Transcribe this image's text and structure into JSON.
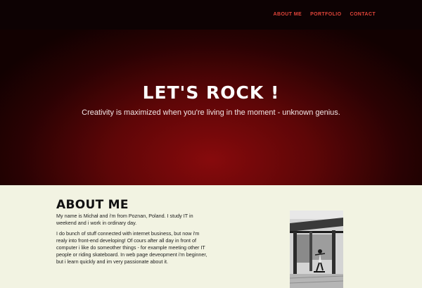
{
  "nav": {
    "items": [
      {
        "label": "ABOUT ME"
      },
      {
        "label": "PORTFOLIO"
      },
      {
        "label": "CONTACT"
      }
    ]
  },
  "hero": {
    "title": "LET'S ROCK !",
    "subtitle": "Creativity is maximized when you're living in the moment - unknown genius."
  },
  "about": {
    "heading": "ABOUT ME",
    "paragraphs": [
      "My name is Michał and i'm from Poznan, Poland. I study IT in weekend and i work in ordinary day.",
      "I do bunch of stuff connected with internet business, but now i'm realy into front-end developing! Of cours after all day in front of computer i like do someother things - for example meeting other IT people or riding skateboard. In web page deveopment i'm beginner, but i learn quickly and im very passionate about it."
    ]
  },
  "colors": {
    "navbar_bg": "#0d0203",
    "nav_link": "#e2453a",
    "hero_center": "#870a0c",
    "hero_edge": "#120101",
    "section_bg": "#f2f3e2"
  }
}
